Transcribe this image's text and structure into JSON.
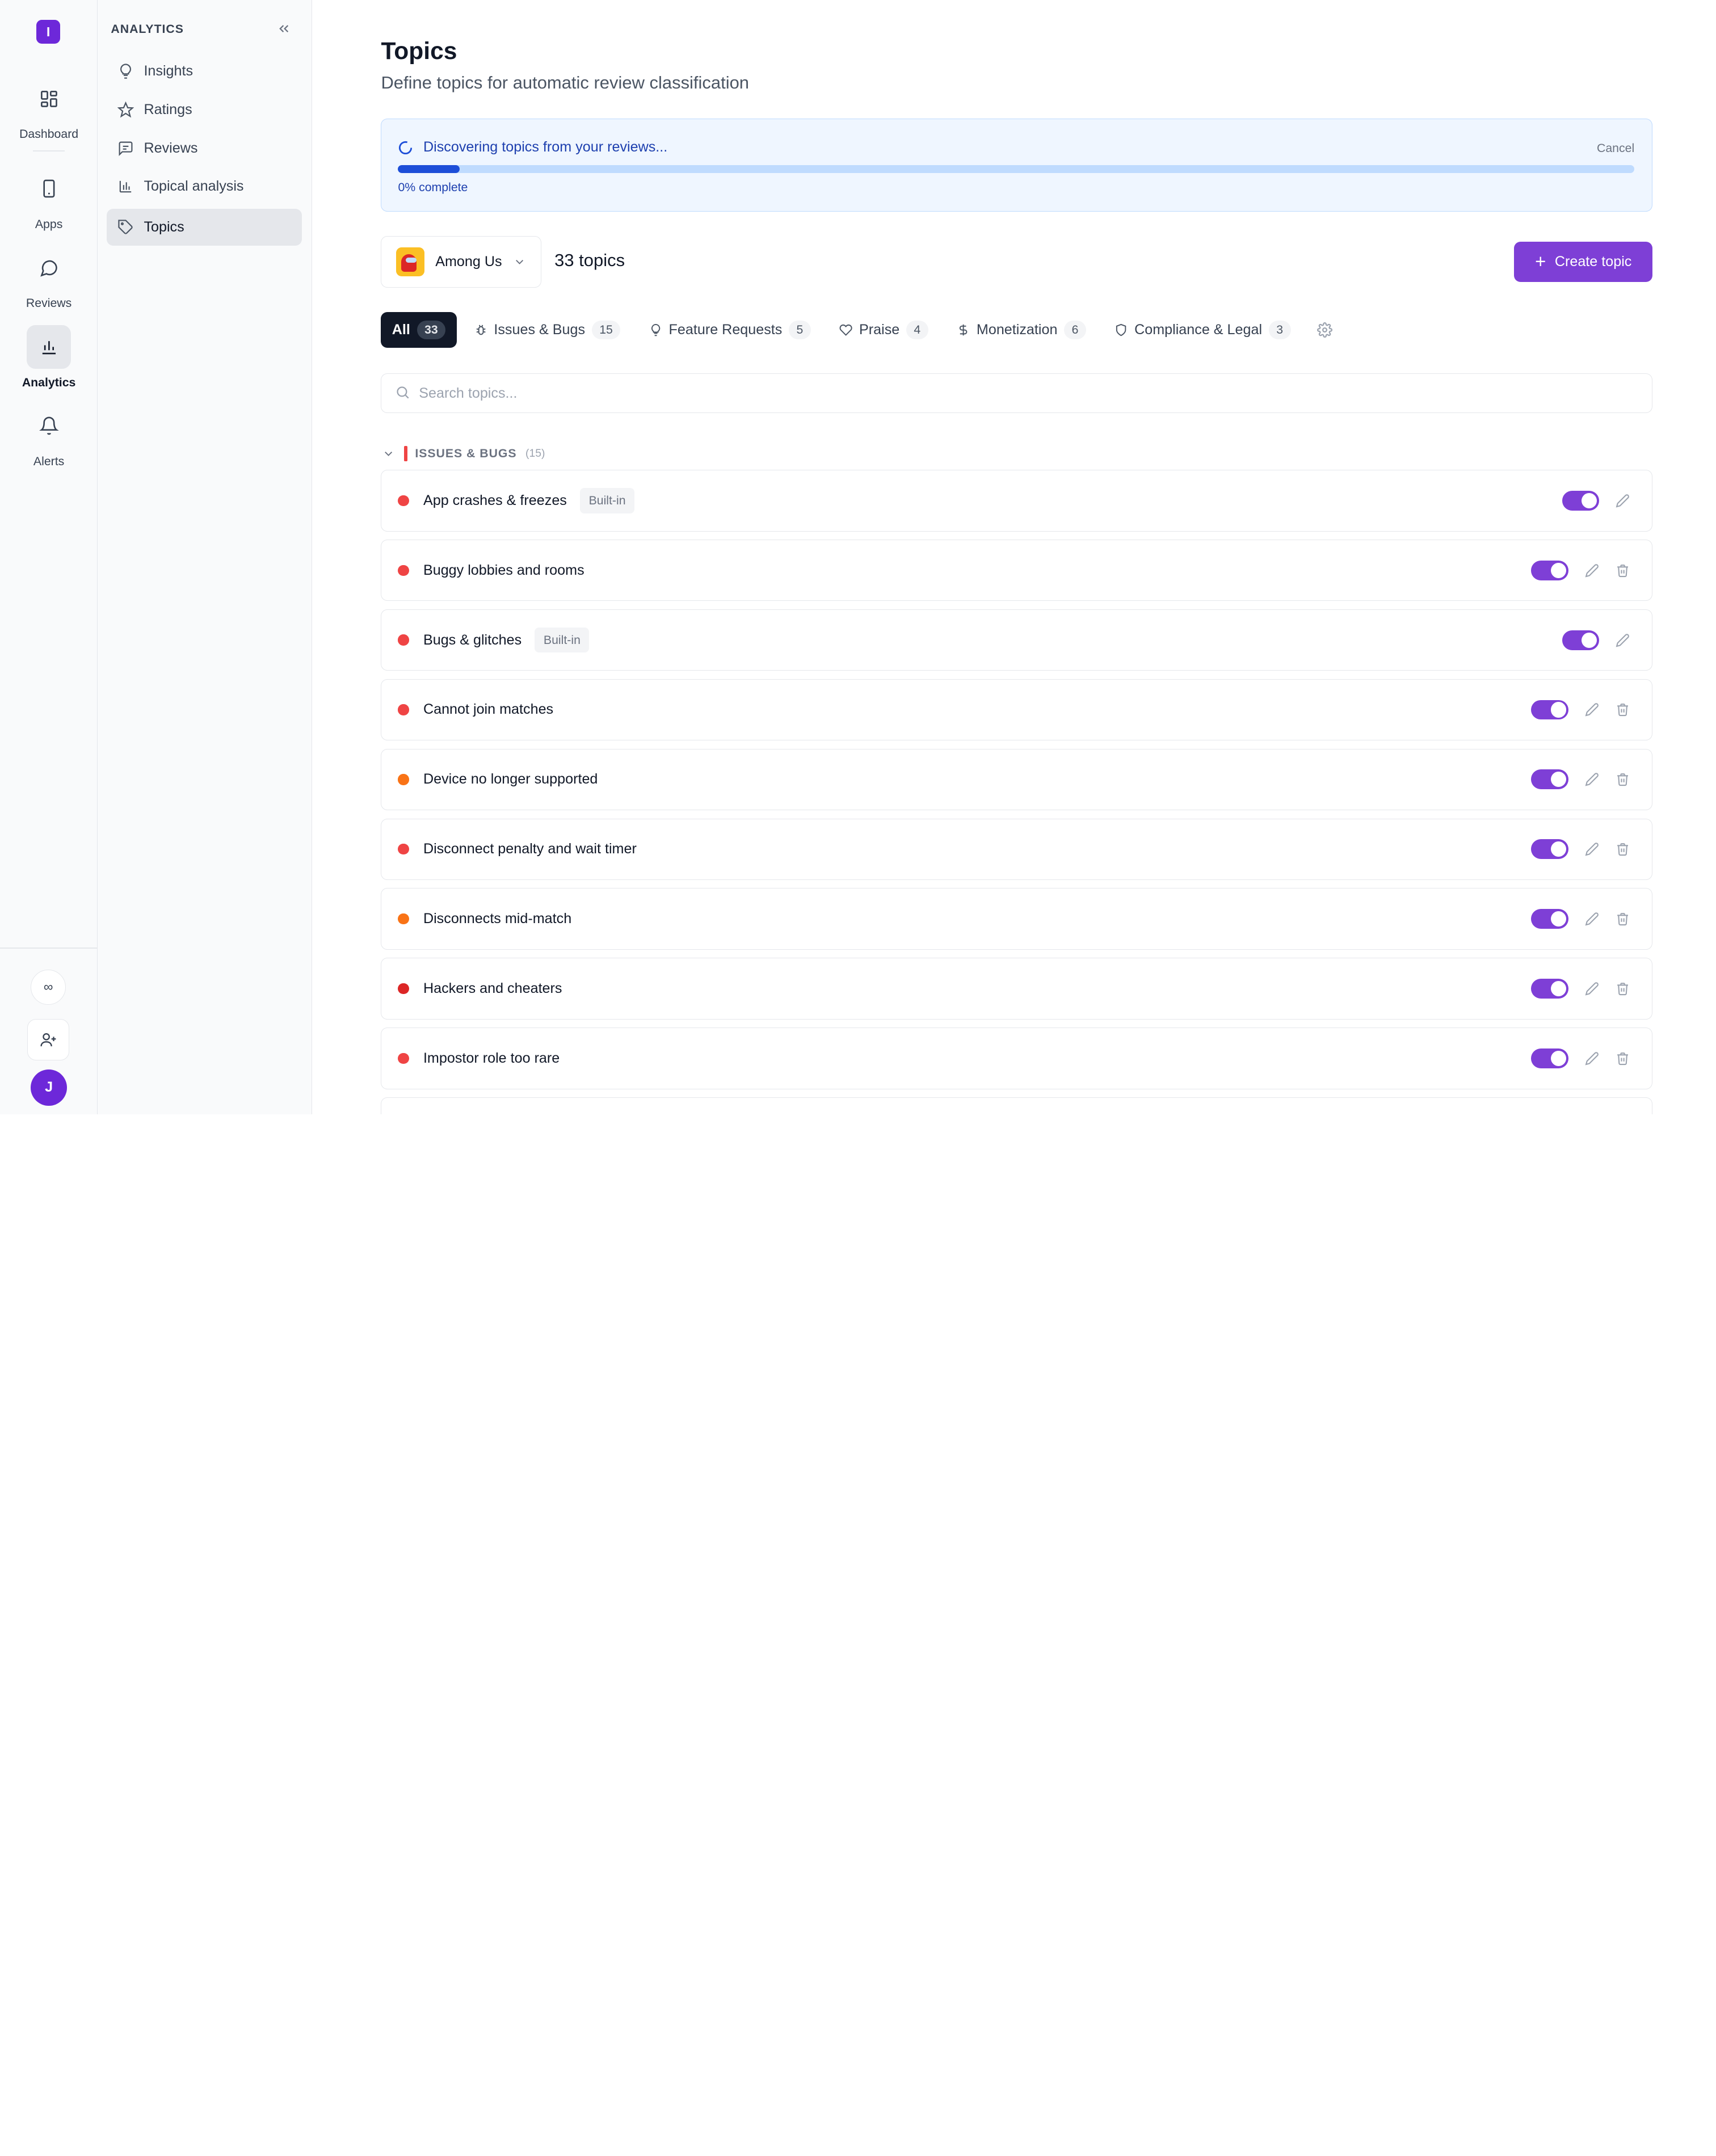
{
  "rail": {
    "logo": "I",
    "items": [
      {
        "label": "Dashboard",
        "icon": "dashboard-icon"
      },
      {
        "label": "Apps",
        "icon": "phone-icon"
      },
      {
        "label": "Reviews",
        "icon": "chat-bubble-icon"
      },
      {
        "label": "Analytics",
        "icon": "bar-chart-icon",
        "active": true
      },
      {
        "label": "Alerts",
        "icon": "bell-icon"
      }
    ],
    "infinity": "∞",
    "avatar": "J"
  },
  "sidebar": {
    "heading": "ANALYTICS",
    "items": [
      {
        "label": "Insights",
        "icon": "lightbulb-icon"
      },
      {
        "label": "Ratings",
        "icon": "star-icon"
      },
      {
        "label": "Reviews",
        "icon": "message-square-icon"
      },
      {
        "label": "Topical analysis",
        "icon": "bar-chart-icon"
      },
      {
        "label": "Topics",
        "icon": "tag-icon",
        "active": true
      }
    ]
  },
  "page": {
    "title": "Topics",
    "subtitle": "Define topics for automatic review classification"
  },
  "progress": {
    "message": "Discovering topics from your reviews...",
    "cancel": "Cancel",
    "percent_text": "0% complete",
    "fill_fraction": 0.05
  },
  "toolbar": {
    "app_name": "Among Us",
    "topic_count": "33 topics",
    "create_label": "Create topic"
  },
  "tabs": [
    {
      "label": "All",
      "count": "33",
      "active": true
    },
    {
      "label": "Issues & Bugs",
      "count": "15",
      "icon": "bug-icon"
    },
    {
      "label": "Feature Requests",
      "count": "5",
      "icon": "lightbulb-icon"
    },
    {
      "label": "Praise",
      "count": "4",
      "icon": "heart-icon"
    },
    {
      "label": "Monetization",
      "count": "6",
      "icon": "dollar-icon"
    },
    {
      "label": "Compliance & Legal",
      "count": "3",
      "icon": "shield-icon"
    }
  ],
  "search": {
    "placeholder": "Search topics..."
  },
  "group": {
    "name": "ISSUES & BUGS",
    "count": "(15)"
  },
  "topics": [
    {
      "name": "App crashes & freezes",
      "badge": "Built-in",
      "dot": "#ef4444",
      "enabled": true
    },
    {
      "name": "Buggy lobbies and rooms",
      "badge": "",
      "dot": "#ef4444",
      "enabled": true
    },
    {
      "name": "Bugs & glitches",
      "badge": "Built-in",
      "dot": "#ef4444",
      "enabled": true
    },
    {
      "name": "Cannot join matches",
      "badge": "",
      "dot": "#ef4444",
      "enabled": true
    },
    {
      "name": "Device no longer supported",
      "badge": "",
      "dot": "#f97316",
      "enabled": true
    },
    {
      "name": "Disconnect penalty and wait timer",
      "badge": "",
      "dot": "#ef4444",
      "enabled": true
    },
    {
      "name": "Disconnects mid-match",
      "badge": "",
      "dot": "#f97316",
      "enabled": true
    },
    {
      "name": "Hackers and cheaters",
      "badge": "",
      "dot": "#dc2626",
      "enabled": true
    },
    {
      "name": "Impostor role too rare",
      "badge": "",
      "dot": "#ef4444",
      "enabled": true
    }
  ],
  "colors": {
    "accent": "#7e3fd6",
    "brand": "#6d28d9",
    "active_tab": "#111827"
  }
}
